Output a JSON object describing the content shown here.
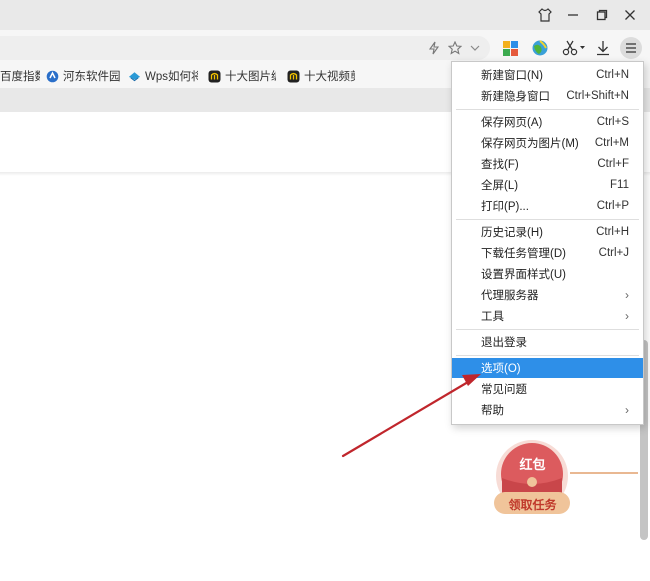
{
  "window": {
    "buttons": [
      "skin-icon",
      "minimize-icon",
      "maximize-icon",
      "close-icon"
    ]
  },
  "bookmarks": [
    {
      "label": "百度指数",
      "icon": "none"
    },
    {
      "label": "河东软件园",
      "icon": "hedong-icon"
    },
    {
      "label": "Wps如何将",
      "icon": "wps-icon"
    },
    {
      "label": "十大图片编",
      "icon": "site-icon"
    },
    {
      "label": "十大视频剪",
      "icon": "site-icon"
    }
  ],
  "menu": {
    "groups": [
      [
        {
          "label": "新建窗口(N)",
          "shortcut": "Ctrl+N"
        },
        {
          "label": "新建隐身窗口",
          "shortcut": "Ctrl+Shift+N"
        }
      ],
      [
        {
          "label": "保存网页(A)",
          "shortcut": "Ctrl+S"
        },
        {
          "label": "保存网页为图片(M)",
          "shortcut": "Ctrl+M"
        },
        {
          "label": "查找(F)",
          "shortcut": "Ctrl+F"
        },
        {
          "label": "全屏(L)",
          "shortcut": "F11"
        },
        {
          "label": "打印(P)...",
          "shortcut": "Ctrl+P"
        }
      ],
      [
        {
          "label": "历史记录(H)",
          "shortcut": "Ctrl+H"
        },
        {
          "label": "下载任务管理(D)",
          "shortcut": "Ctrl+J"
        },
        {
          "label": "设置界面样式(U)",
          "shortcut": ""
        },
        {
          "label": "代理服务器",
          "shortcut": "",
          "submenu": true
        },
        {
          "label": "工具",
          "shortcut": "",
          "submenu": true
        }
      ],
      [
        {
          "label": "退出登录",
          "shortcut": ""
        }
      ],
      [
        {
          "label": "选项(O)",
          "shortcut": "",
          "highlighted": true
        },
        {
          "label": "常见问题",
          "shortcut": ""
        },
        {
          "label": "帮助",
          "shortcut": "",
          "submenu": true
        }
      ]
    ]
  },
  "promo": {
    "top_label": "红包",
    "bottom_label": "领取任务"
  },
  "colors": {
    "highlight": "#2e8fe8",
    "arrow": "#c0262c",
    "packet_red": "#d9575a",
    "packet_gold": "#f0c49a"
  }
}
